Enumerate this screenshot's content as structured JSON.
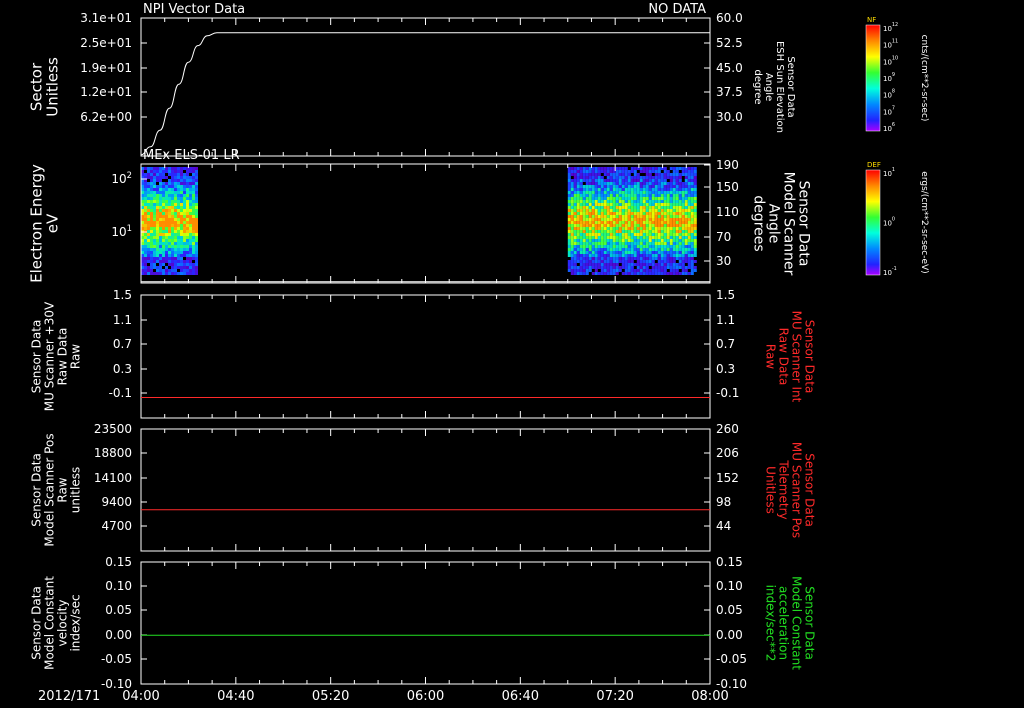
{
  "date_label": "2012/171",
  "time_ticks": [
    "04:00",
    "04:40",
    "05:20",
    "06:00",
    "06:40",
    "07:20",
    "08:00"
  ],
  "colors": {
    "white": "#ffffff",
    "red": "#ff2a2a",
    "green": "#22e022"
  },
  "colorbars": [
    {
      "title": "NF",
      "unit": "cnts/(cm**2-sr-sec)",
      "ticks": [
        "10^12",
        "10^11",
        "10^10",
        "10^9",
        "10^8",
        "10^7",
        "10^6"
      ]
    },
    {
      "title": "DEF",
      "unit": "ergs/(cm**2-sr-sec-eV)",
      "ticks": [
        "10^1",
        "10^0",
        "10^-1"
      ]
    }
  ],
  "chart_data": [
    {
      "type": "line",
      "panel_title": "NPI Vector Data",
      "status": "NO DATA",
      "left_label": [
        "Sector",
        "Unitless"
      ],
      "left_ticks": [
        "3.1e+01",
        "2.5e+01",
        "1.9e+01",
        "1.2e+01",
        "6.2e+00"
      ],
      "right_label": [
        "Sensor Data",
        "ESH Sun Elevation",
        "Angle",
        "degree"
      ],
      "right_ticks": [
        "60.0",
        "52.5",
        "45.0",
        "37.5",
        "30.0"
      ],
      "ylim_right": [
        22.5,
        60.0
      ],
      "series": [
        {
          "axis": "right",
          "color": "#ffffff",
          "x": [
            "04:00",
            "04:04",
            "04:08",
            "04:12",
            "04:16",
            "04:20",
            "04:24",
            "04:28",
            "04:32",
            "08:00"
          ],
          "values": [
            22.8,
            25.0,
            29.5,
            35.5,
            42.0,
            48.0,
            52.5,
            55.2,
            56.0,
            56.0
          ]
        }
      ]
    },
    {
      "type": "heatmap",
      "panel_title": "MEx ELS-01 LR",
      "left_label": [
        "Electron Energy",
        "eV"
      ],
      "left_ticks": [
        "10^2",
        "10^1"
      ],
      "right_label": [
        "Sensor Data",
        "Model Scanner",
        "Angle",
        "degrees"
      ],
      "right_ticks": [
        "190",
        "150",
        "110",
        "70",
        "30"
      ],
      "ylim_right": [
        10,
        190
      ],
      "data_blocks": [
        {
          "start": "04:00",
          "end": "04:24"
        },
        {
          "start": "07:00",
          "end": "07:54"
        }
      ],
      "series": [
        {
          "axis": "right",
          "color": "#ffffff",
          "values": [
            12,
            12
          ]
        }
      ]
    },
    {
      "type": "line",
      "left_label": [
        "Sensor Data",
        "MU Scanner +30V",
        "Raw Data",
        "Raw"
      ],
      "left_ticks": [
        "1.5",
        "1.1",
        "0.7",
        "0.3",
        "-0.1"
      ],
      "right_label": [
        "Sensor Data",
        "MU Scanner Int",
        "Raw Data",
        "Raw"
      ],
      "right_label_color": "#ff2a2a",
      "right_ticks": [
        "1.5",
        "1.1",
        "0.7",
        "0.3",
        "-0.1"
      ],
      "ylim": [
        -0.3,
        1.5
      ],
      "series": [
        {
          "axis": "left",
          "color": "#ff2a2a",
          "values": [
            0.0,
            0.0
          ]
        }
      ]
    },
    {
      "type": "line",
      "left_label": [
        "Sensor Data",
        "Model Scanner Pos",
        "Raw",
        "unitless"
      ],
      "left_ticks": [
        "23500",
        "18800",
        "14100",
        "9400",
        "4700"
      ],
      "right_label": [
        "Sensor Data",
        "MU Scanner Pos",
        "Telemetry",
        "Unitless"
      ],
      "right_label_color": "#ff2a2a",
      "right_ticks": [
        "260",
        "206",
        "152",
        "98",
        "44"
      ],
      "ylim_right": [
        0,
        260
      ],
      "series": [
        {
          "axis": "right",
          "color": "#ff2a2a",
          "values": [
            88,
            88
          ]
        }
      ]
    },
    {
      "type": "line",
      "left_label": [
        "Sensor Data",
        "Model Constant",
        "velocity",
        "index/sec"
      ],
      "left_ticks": [
        "0.15",
        "0.10",
        "0.05",
        "0.00",
        "-0.05",
        "-0.10"
      ],
      "right_label": [
        "Sensor Data",
        "Model Constant",
        "acceleration",
        "index/sec**2"
      ],
      "right_label_color": "#22e022",
      "right_ticks": [
        "0.15",
        "0.10",
        "0.05",
        "0.00",
        "-0.05",
        "-0.10"
      ],
      "ylim": [
        -0.1,
        0.15
      ],
      "series": [
        {
          "axis": "left",
          "color": "#22e022",
          "values": [
            0.0,
            0.0
          ]
        }
      ]
    }
  ]
}
